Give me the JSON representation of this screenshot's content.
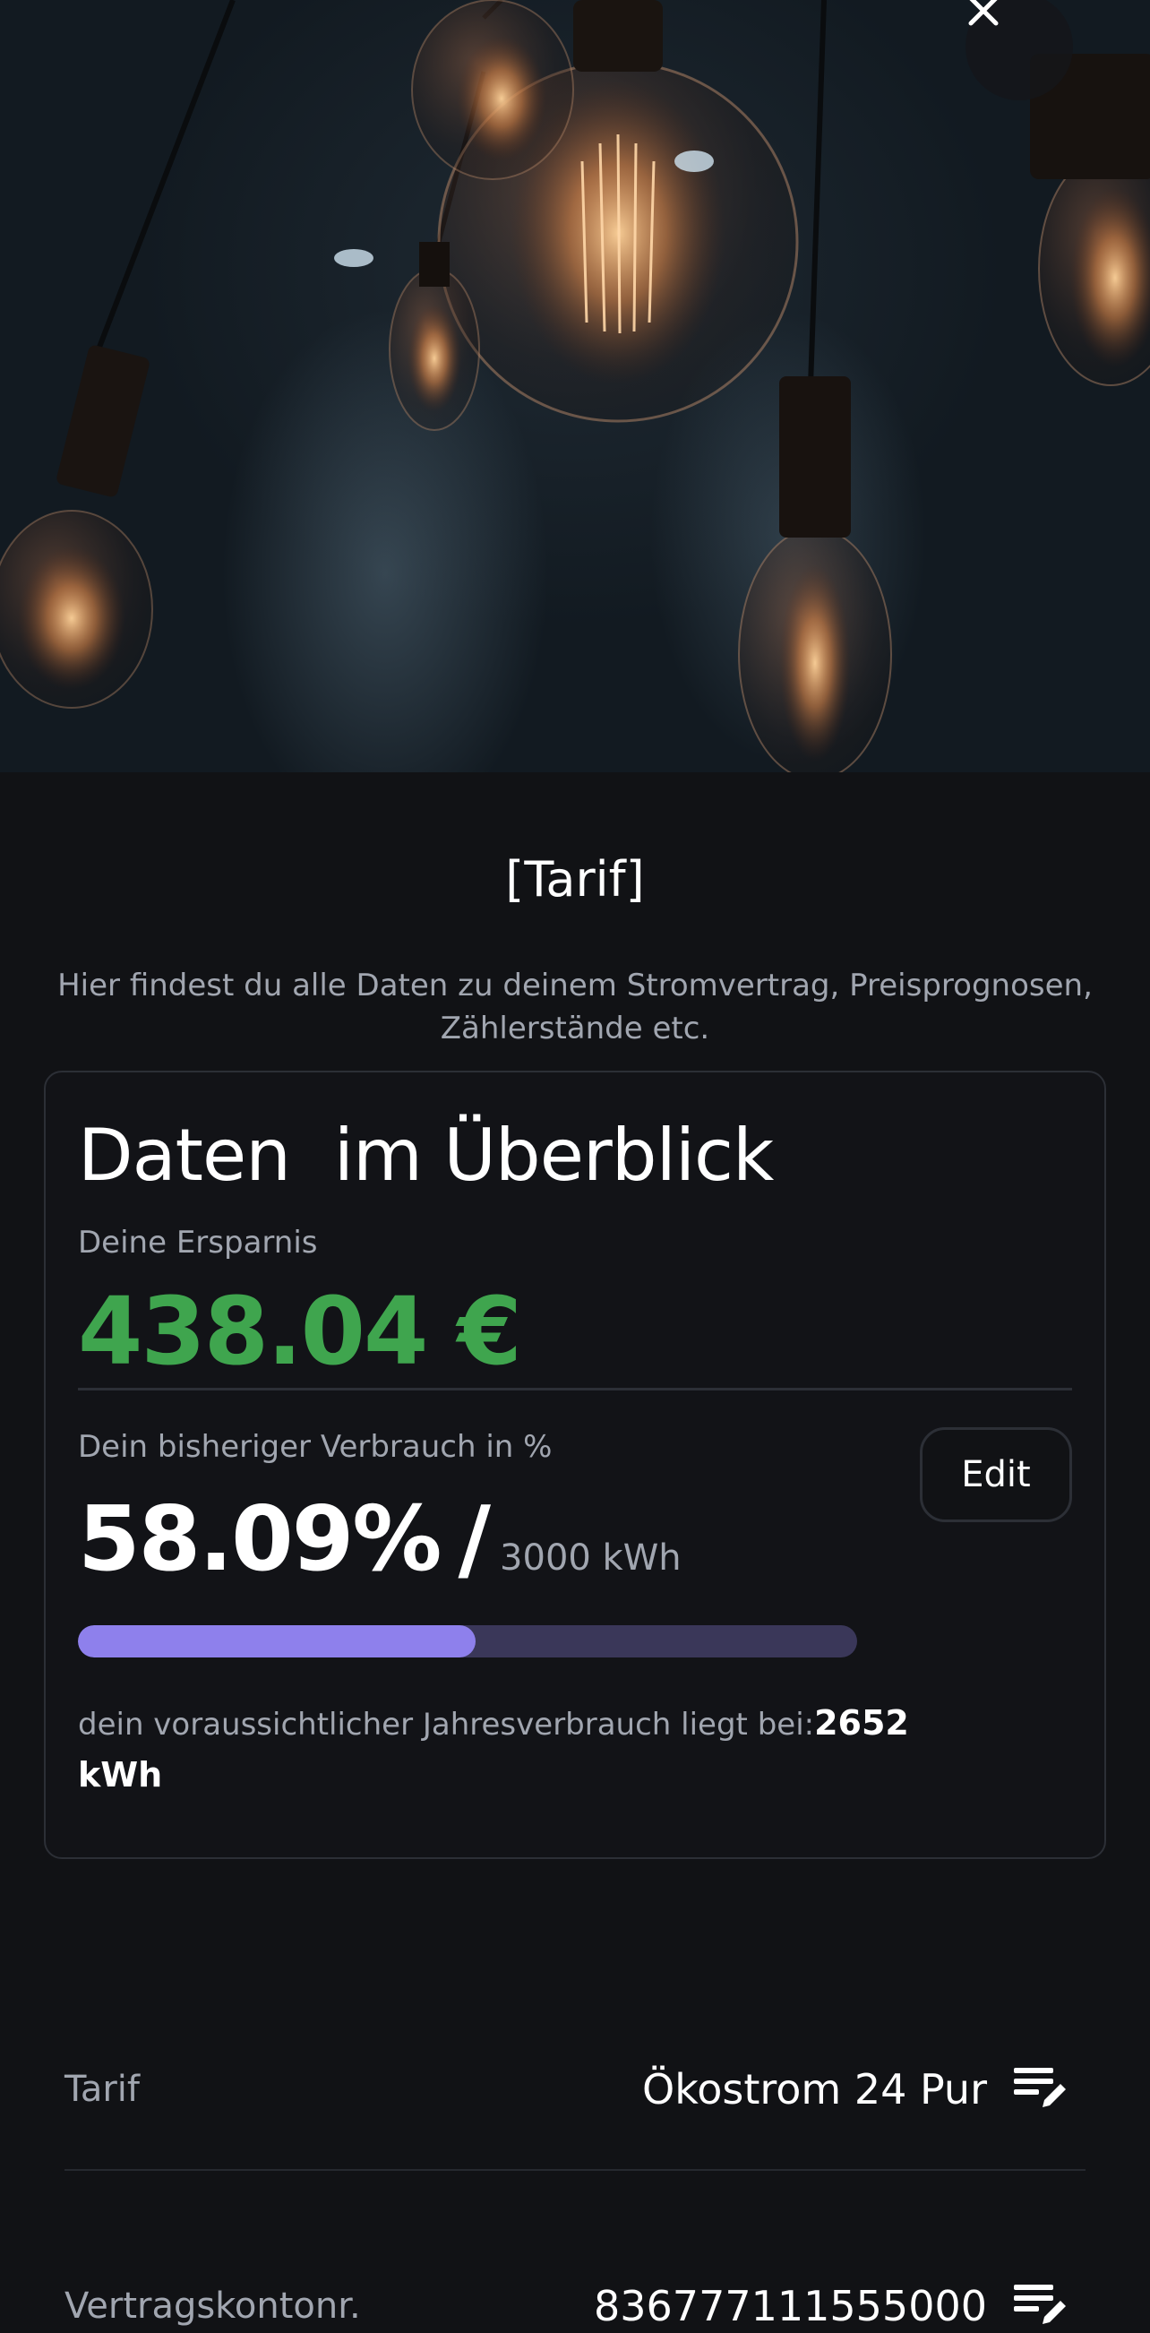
{
  "hero": {
    "close_icon": "close-icon"
  },
  "header": {
    "title": "[Tarif]",
    "subtitle": "Hier findest du alle Daten zu deinem Stromvertrag, Preisprognosen, Zählerstände etc."
  },
  "overview": {
    "title": "Daten  im Überblick",
    "savings_label": "Deine Ersparnis",
    "savings_value": "438.04 €",
    "usage_label": "Dein bisheriger Verbrauch in %",
    "usage_percent": "58.09%",
    "usage_slash": "/",
    "usage_total": "3000 kWh",
    "edit_label": "Edit",
    "progress_fraction": 0.51,
    "forecast_text": "dein voraussichtlicher Jahresverbrauch liegt bei:",
    "forecast_value": "2652 kWh"
  },
  "details": [
    {
      "label": "Tarif",
      "value": "Ökostrom 24 Pur",
      "icon": "edit-list-icon"
    },
    {
      "label": "Vertragskontonr.",
      "value": "836777111555000",
      "icon": "edit-list-icon"
    }
  ],
  "colors": {
    "background": "#111215",
    "savings_green": "#3fa54e",
    "progress_fill": "#8e80ec",
    "progress_track": "#3a3759"
  }
}
